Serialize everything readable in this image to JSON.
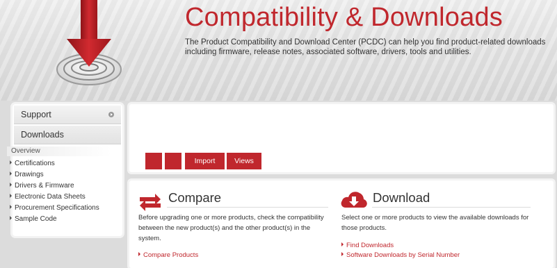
{
  "banner": {
    "title": "Compatibility & Downloads",
    "description": "The Product Compatibility and Download Center (PCDC) can help you find product-related downloads including firmware, release notes, associated software, drivers, tools and utilities."
  },
  "sidebar": {
    "support_label": "Support",
    "downloads_label": "Downloads",
    "overview_label": "Overview",
    "items": [
      {
        "label": "Certifications"
      },
      {
        "label": "Drawings"
      },
      {
        "label": "Drivers & Firmware"
      },
      {
        "label": "Electronic Data Sheets"
      },
      {
        "label": "Procurement Specifications"
      },
      {
        "label": "Sample Code"
      }
    ]
  },
  "toolbar": {
    "import_label": "Import",
    "views_label": "Views"
  },
  "compare": {
    "title": "Compare",
    "description": "Before upgrading one or more products, check the compatibility between the new product(s) and the other product(s) in the system.",
    "link_label": "Compare Products"
  },
  "download": {
    "title": "Download",
    "description": "Select one or more products to view the available downloads for those products.",
    "links": [
      {
        "label": "Find Downloads"
      },
      {
        "label": "Software Downloads by Serial Number"
      }
    ]
  },
  "colors": {
    "accent": "#c0272d",
    "background": "#dcdcdc"
  }
}
